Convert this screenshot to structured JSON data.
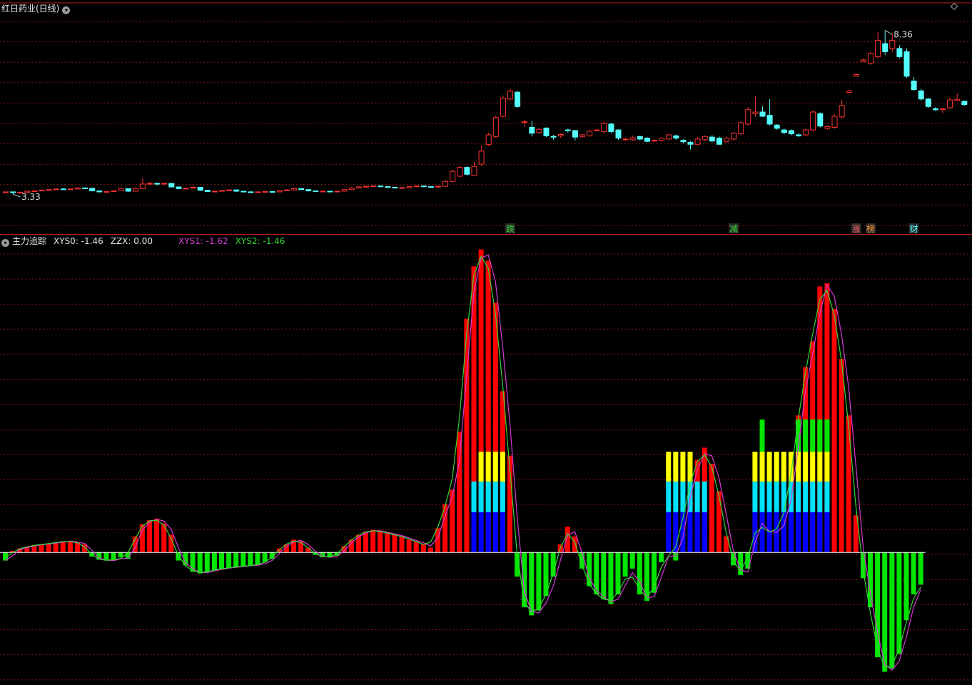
{
  "title": "红日药业(日线)",
  "indicator": {
    "name": "主力追踪",
    "items": [
      {
        "text": "XYS0: -1.46",
        "color": "#e6e6e6"
      },
      {
        "text": "ZZX: 0.00",
        "color": "#e6e6e6"
      },
      {
        "text": "XYS1: -1.62",
        "color": "#d63ad6"
      },
      {
        "text": "XYS2: -1.46",
        "color": "#36d636"
      }
    ]
  },
  "colors": {
    "up": "#ff3232",
    "down": "#54ffff",
    "grid": "#801818",
    "pos_bar": "#ff0000",
    "neg_bar": "#00e600",
    "blue_bar": "#0000ff",
    "cyan_bar": "#00e0ff",
    "yellow_bar": "#ffff00",
    "xys1_line": "#d63ad6",
    "xys2_line": "#36d636"
  },
  "chart_data": [
    {
      "type": "candlestick",
      "price_range": [
        2.5,
        8.85
      ],
      "annotations": {
        "low_label": "3.33",
        "high_label": "8.36"
      },
      "signal_labels": [
        {
          "index": 70,
          "text": "跌",
          "color": "#36d636"
        },
        {
          "index": 101,
          "text": "减",
          "color": "#36d636"
        },
        {
          "index": 118,
          "text": "涨",
          "color": "#ff6060"
        },
        {
          "index": 120,
          "text": "榜",
          "color": "#ff9933"
        },
        {
          "index": 126,
          "text": "财",
          "color": "#54ffff"
        }
      ],
      "candles": [
        [
          3.38,
          3.4,
          3.41,
          3.36
        ],
        [
          3.4,
          3.38,
          3.41,
          3.33
        ],
        [
          3.38,
          3.39,
          3.4,
          3.36
        ],
        [
          3.39,
          3.42,
          3.43,
          3.38
        ],
        [
          3.42,
          3.43,
          3.44,
          3.4
        ],
        [
          3.43,
          3.45,
          3.47,
          3.42
        ],
        [
          3.45,
          3.47,
          3.48,
          3.44
        ],
        [
          3.47,
          3.49,
          3.5,
          3.46
        ],
        [
          3.49,
          3.48,
          3.51,
          3.46
        ],
        [
          3.48,
          3.49,
          3.5,
          3.46
        ],
        [
          3.49,
          3.52,
          3.54,
          3.48
        ],
        [
          3.52,
          3.51,
          3.54,
          3.49
        ],
        [
          3.51,
          3.43,
          3.52,
          3.42
        ],
        [
          3.43,
          3.4,
          3.44,
          3.38
        ],
        [
          3.4,
          3.41,
          3.43,
          3.39
        ],
        [
          3.41,
          3.43,
          3.44,
          3.4
        ],
        [
          3.43,
          3.5,
          3.52,
          3.42
        ],
        [
          3.5,
          3.42,
          3.51,
          3.4
        ],
        [
          3.42,
          3.5,
          3.53,
          3.41
        ],
        [
          3.5,
          3.64,
          3.82,
          3.49
        ],
        [
          3.64,
          3.66,
          3.7,
          3.6
        ],
        [
          3.66,
          3.64,
          3.68,
          3.6
        ],
        [
          3.64,
          3.66,
          3.68,
          3.62
        ],
        [
          3.66,
          3.55,
          3.67,
          3.54
        ],
        [
          3.55,
          3.5,
          3.57,
          3.48
        ],
        [
          3.5,
          3.51,
          3.53,
          3.48
        ],
        [
          3.51,
          3.54,
          3.6,
          3.5
        ],
        [
          3.54,
          3.45,
          3.55,
          3.43
        ],
        [
          3.45,
          3.41,
          3.46,
          3.4
        ],
        [
          3.41,
          3.42,
          3.43,
          3.4
        ],
        [
          3.42,
          3.44,
          3.46,
          3.41
        ],
        [
          3.44,
          3.46,
          3.48,
          3.43
        ],
        [
          3.46,
          3.42,
          3.47,
          3.4
        ],
        [
          3.42,
          3.4,
          3.43,
          3.38
        ],
        [
          3.4,
          3.39,
          3.42,
          3.38
        ],
        [
          3.39,
          3.4,
          3.42,
          3.38
        ],
        [
          3.4,
          3.41,
          3.43,
          3.39
        ],
        [
          3.41,
          3.4,
          3.42,
          3.39
        ],
        [
          3.4,
          3.44,
          3.46,
          3.39
        ],
        [
          3.44,
          3.46,
          3.48,
          3.43
        ],
        [
          3.46,
          3.5,
          3.53,
          3.45
        ],
        [
          3.5,
          3.47,
          3.51,
          3.45
        ],
        [
          3.47,
          3.43,
          3.48,
          3.41
        ],
        [
          3.43,
          3.42,
          3.44,
          3.4
        ],
        [
          3.42,
          3.42,
          3.44,
          3.4
        ],
        [
          3.42,
          3.41,
          3.43,
          3.39
        ],
        [
          3.41,
          3.42,
          3.44,
          3.4
        ],
        [
          3.42,
          3.47,
          3.49,
          3.41
        ],
        [
          3.47,
          3.52,
          3.55,
          3.46
        ],
        [
          3.52,
          3.55,
          3.57,
          3.51
        ],
        [
          3.55,
          3.57,
          3.59,
          3.54
        ],
        [
          3.57,
          3.58,
          3.6,
          3.55
        ],
        [
          3.58,
          3.56,
          3.6,
          3.54
        ],
        [
          3.56,
          3.54,
          3.58,
          3.52
        ],
        [
          3.54,
          3.52,
          3.56,
          3.5
        ],
        [
          3.52,
          3.53,
          3.55,
          3.51
        ],
        [
          3.53,
          3.56,
          3.58,
          3.52
        ],
        [
          3.56,
          3.58,
          3.6,
          3.55
        ],
        [
          3.58,
          3.56,
          3.6,
          3.54
        ],
        [
          3.56,
          3.55,
          3.58,
          3.53
        ],
        [
          3.55,
          3.57,
          3.59,
          3.54
        ],
        [
          3.57,
          3.72,
          3.75,
          3.56
        ],
        [
          3.72,
          4.03,
          4.08,
          3.7
        ],
        [
          3.88,
          4.15,
          4.2,
          3.85
        ],
        [
          4.15,
          3.94,
          4.18,
          3.9
        ],
        [
          3.9,
          4.18,
          4.32,
          3.88
        ],
        [
          4.25,
          4.65,
          4.82,
          4.2
        ],
        [
          4.85,
          5.15,
          5.22,
          4.8
        ],
        [
          5.1,
          5.68,
          5.74,
          5.05
        ],
        [
          5.72,
          6.28,
          6.36,
          5.68
        ],
        [
          6.25,
          6.49,
          6.55,
          6.2
        ],
        [
          6.46,
          6.02,
          6.5,
          5.98
        ],
        [
          5.55,
          5.55,
          5.62,
          5.4
        ],
        [
          5.38,
          5.2,
          5.58,
          5.1
        ],
        [
          5.22,
          5.32,
          5.36,
          5.18
        ],
        [
          5.36,
          5.12,
          5.38,
          5.08
        ],
        [
          5.1,
          5.08,
          5.15,
          5.0
        ],
        [
          5.12,
          5.16,
          5.2,
          5.06
        ],
        [
          5.3,
          5.28,
          5.34,
          5.22
        ],
        [
          5.28,
          5.08,
          5.3,
          4.98
        ],
        [
          5.1,
          5.15,
          5.18,
          5.06
        ],
        [
          5.12,
          5.26,
          5.3,
          5.1
        ],
        [
          5.28,
          5.3,
          5.34,
          5.26
        ],
        [
          5.25,
          5.5,
          5.56,
          5.2
        ],
        [
          5.48,
          5.25,
          5.52,
          5.2
        ],
        [
          5.3,
          5.05,
          5.32,
          5.0
        ],
        [
          5.02,
          5.02,
          5.06,
          4.96
        ],
        [
          5.0,
          5.06,
          5.12,
          4.96
        ],
        [
          5.1,
          5.02,
          5.12,
          4.98
        ],
        [
          5.05,
          4.95,
          5.08,
          4.92
        ],
        [
          4.98,
          4.98,
          5.02,
          4.94
        ],
        [
          4.98,
          5.05,
          5.08,
          4.94
        ],
        [
          5.02,
          5.15,
          5.18,
          5.0
        ],
        [
          5.12,
          5.05,
          5.16,
          5.0
        ],
        [
          4.98,
          4.94,
          5.02,
          4.88
        ],
        [
          4.92,
          4.86,
          4.96,
          4.7
        ],
        [
          4.86,
          5.02,
          5.08,
          4.84
        ],
        [
          5.0,
          5.1,
          5.12,
          4.96
        ],
        [
          5.08,
          4.96,
          5.14,
          4.92
        ],
        [
          5.05,
          4.86,
          5.1,
          4.84
        ],
        [
          4.95,
          5.05,
          5.1,
          4.9
        ],
        [
          5.02,
          5.2,
          5.24,
          4.98
        ],
        [
          5.18,
          5.52,
          5.56,
          5.14
        ],
        [
          5.48,
          5.92,
          6.0,
          5.44
        ],
        [
          5.8,
          5.85,
          6.34,
          5.7
        ],
        [
          5.85,
          5.72,
          6.02,
          5.7
        ],
        [
          5.75,
          5.48,
          6.24,
          5.44
        ],
        [
          5.45,
          5.35,
          5.48,
          5.3
        ],
        [
          5.3,
          5.22,
          5.34,
          5.18
        ],
        [
          5.28,
          5.18,
          5.32,
          5.14
        ],
        [
          5.15,
          5.12,
          5.2,
          5.08
        ],
        [
          5.15,
          5.3,
          5.34,
          5.12
        ],
        [
          5.3,
          5.85,
          5.9,
          5.26
        ],
        [
          5.8,
          5.42,
          5.84,
          5.38
        ],
        [
          5.35,
          5.4,
          5.45,
          5.3
        ],
        [
          5.38,
          5.72,
          5.78,
          5.34
        ],
        [
          5.7,
          6.05,
          6.22,
          5.66
        ],
        [
          6.45,
          6.5,
          6.54,
          6.44
        ],
        [
          6.95,
          7.0,
          7.04,
          6.94
        ],
        [
          7.4,
          7.45,
          7.49,
          7.39
        ],
        [
          7.35,
          7.65,
          7.7,
          7.3
        ],
        [
          7.55,
          8.05,
          8.3,
          7.5
        ],
        [
          7.95,
          7.7,
          8.36,
          7.6
        ],
        [
          7.8,
          8.05,
          8.25,
          7.7
        ],
        [
          7.8,
          7.55,
          7.9,
          7.5
        ],
        [
          7.7,
          6.95,
          7.8,
          6.9
        ],
        [
          6.8,
          6.54,
          6.92,
          6.5
        ],
        [
          6.5,
          6.25,
          6.56,
          6.2
        ],
        [
          6.25,
          6.02,
          6.28,
          5.98
        ],
        [
          5.95,
          5.92,
          6.0,
          5.88
        ],
        [
          5.94,
          5.95,
          5.98,
          5.82
        ],
        [
          5.98,
          6.22,
          6.3,
          5.94
        ],
        [
          6.2,
          6.24,
          6.42,
          6.18
        ],
        [
          6.18,
          6.08,
          6.2,
          6.04
        ]
      ]
    },
    {
      "type": "bar",
      "title": "主力追踪",
      "yrange": [
        -1.6,
        3.8
      ],
      "values": [
        -0.1,
        0.02,
        0.05,
        0.07,
        0.09,
        0.1,
        0.11,
        0.12,
        0.14,
        0.14,
        0.12,
        0.1,
        -0.05,
        -0.09,
        -0.1,
        -0.1,
        -0.06,
        -0.08,
        0.2,
        0.35,
        0.4,
        0.42,
        0.36,
        0.22,
        -0.1,
        -0.16,
        -0.24,
        -0.26,
        -0.24,
        -0.22,
        -0.2,
        -0.19,
        -0.18,
        -0.17,
        -0.16,
        -0.16,
        -0.12,
        -0.08,
        0.05,
        0.1,
        0.16,
        0.14,
        0.06,
        -0.03,
        -0.06,
        -0.06,
        -0.04,
        0.08,
        0.16,
        0.22,
        0.26,
        0.28,
        0.26,
        0.24,
        0.22,
        0.2,
        0.16,
        0.14,
        0.1,
        0.06,
        0.3,
        0.6,
        0.78,
        1.5,
        2.9,
        3.55,
        3.76,
        3.62,
        3.1,
        2.0,
        1.2,
        -0.3,
        -0.68,
        -0.78,
        -0.72,
        -0.54,
        -0.3,
        0.1,
        0.32,
        0.2,
        -0.2,
        -0.42,
        -0.52,
        -0.58,
        -0.64,
        -0.52,
        -0.3,
        -0.2,
        -0.52,
        -0.6,
        -0.5,
        -0.12,
        0.02,
        -0.1,
        0.45,
        0.9,
        1.15,
        1.3,
        1.1,
        0.76,
        0.2,
        -0.16,
        -0.28,
        -0.2,
        0.44,
        0.28,
        0.24,
        0.26,
        0.4,
        0.9,
        1.7,
        2.3,
        2.62,
        3.3,
        3.34,
        3.02,
        2.4,
        1.7,
        0.46,
        -0.32,
        -0.68,
        -1.3,
        -1.48,
        -1.44,
        -1.26,
        -0.84,
        -0.52,
        -0.4
      ],
      "overlay": {
        "cyan_indices": [
          65,
          66,
          67,
          68,
          69,
          92,
          93,
          94,
          95,
          96,
          97,
          104,
          105,
          106,
          107,
          108,
          109,
          110,
          111,
          112,
          113,
          114
        ],
        "yellow_indices": [
          66,
          67,
          68,
          69,
          92,
          93,
          94,
          95,
          104,
          105,
          106,
          107,
          108,
          109,
          110,
          111,
          112,
          113,
          114
        ],
        "green_indices": [
          105,
          110,
          111,
          112,
          113,
          114
        ]
      },
      "series": [
        {
          "name": "XYS1",
          "last": -1.62
        },
        {
          "name": "XYS2",
          "last": -1.46
        }
      ]
    }
  ]
}
